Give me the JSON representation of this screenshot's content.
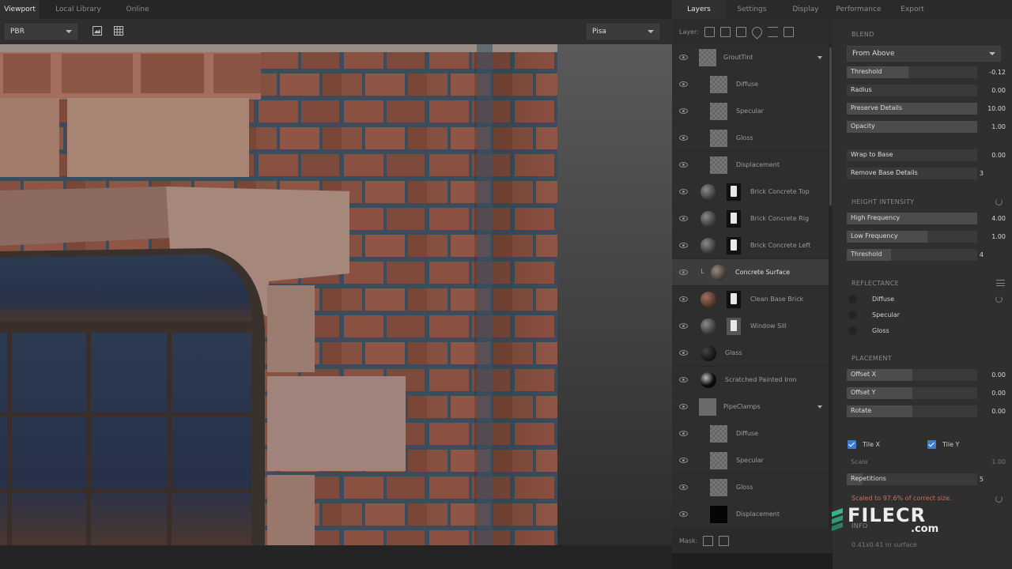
{
  "top_tabs_left": [
    "Viewport",
    "Local Library",
    "Online"
  ],
  "top_tabs_right": [
    "Layers",
    "Settings",
    "Display",
    "Performance",
    "Export"
  ],
  "viewport": {
    "render_mode": "PBR",
    "environment": "Pisa"
  },
  "layers_panel": {
    "layer_label": "Layer:",
    "mask_label": "Mask:",
    "items": [
      {
        "name": "GroutTint",
        "kind": "group"
      },
      {
        "name": "Diffuse",
        "kind": "channel"
      },
      {
        "name": "Specular",
        "kind": "channel"
      },
      {
        "name": "Gloss",
        "kind": "channel"
      },
      {
        "name": "Displacement",
        "kind": "channel"
      },
      {
        "name": "Brick Concrete Top",
        "kind": "material"
      },
      {
        "name": "Brick Concrete Rig",
        "kind": "material"
      },
      {
        "name": "Brick Concrete Left",
        "kind": "material"
      },
      {
        "name": "Concrete Surface",
        "kind": "material",
        "selected": true
      },
      {
        "name": "Clean Base Brick",
        "kind": "material"
      },
      {
        "name": "Window Sill",
        "kind": "material"
      },
      {
        "name": "Glass",
        "kind": "material"
      },
      {
        "name": "Scratched Painted Iron",
        "kind": "material"
      },
      {
        "name": "PipeClamps",
        "kind": "group"
      },
      {
        "name": "Diffuse",
        "kind": "channel"
      },
      {
        "name": "Specular",
        "kind": "channel"
      },
      {
        "name": "Gloss",
        "kind": "channel"
      },
      {
        "name": "Displacement",
        "kind": "channel"
      }
    ]
  },
  "settings": {
    "blend": {
      "title": "BLEND",
      "mode": "From Above",
      "sliders": [
        {
          "label": "Threshold",
          "value": "-0.12",
          "fill": 0.47
        },
        {
          "label": "Radius",
          "value": "0.00",
          "fill": 0.0
        },
        {
          "label": "Preserve Details",
          "value": "10.00",
          "fill": 1.0
        },
        {
          "label": "Opacity",
          "value": "1.00",
          "fill": 1.0
        },
        {
          "label": "Wrap to Base",
          "value": "0.00",
          "fill": 0.0
        },
        {
          "label": "Remove Base Details",
          "value": "3",
          "fill": 0.0
        }
      ]
    },
    "height_intensity": {
      "title": "HEIGHT INTENSITY",
      "sliders": [
        {
          "label": "High Frequency",
          "value": "4.00",
          "fill": 1.0
        },
        {
          "label": "Low Frequency",
          "value": "1.00",
          "fill": 0.62
        },
        {
          "label": "Threshold",
          "value": "4",
          "fill": 0.34
        }
      ]
    },
    "reflectance": {
      "title": "REFLECTANCE",
      "options": [
        "Diffuse",
        "Specular",
        "Gloss"
      ]
    },
    "placement": {
      "title": "PLACEMENT",
      "sliders": [
        {
          "label": "Offset X",
          "value": "0.00",
          "fill": 0.5
        },
        {
          "label": "Offset Y",
          "value": "0.00",
          "fill": 0.5
        },
        {
          "label": "Rotate",
          "value": "0.00",
          "fill": 0.5
        }
      ],
      "tile_x": "Tile X",
      "tile_y": "Tile Y",
      "scale_label": "Scale",
      "scale_value": "1.00",
      "repetitions_label": "Repetitions",
      "repetitions_value": "5",
      "warning": "Scaled to 97.6% of correct size.",
      "info_title": "INFO",
      "info_text": "0.41x0.41 m surface"
    }
  },
  "watermark": {
    "brand": "FILECR",
    "suffix": ".com"
  }
}
